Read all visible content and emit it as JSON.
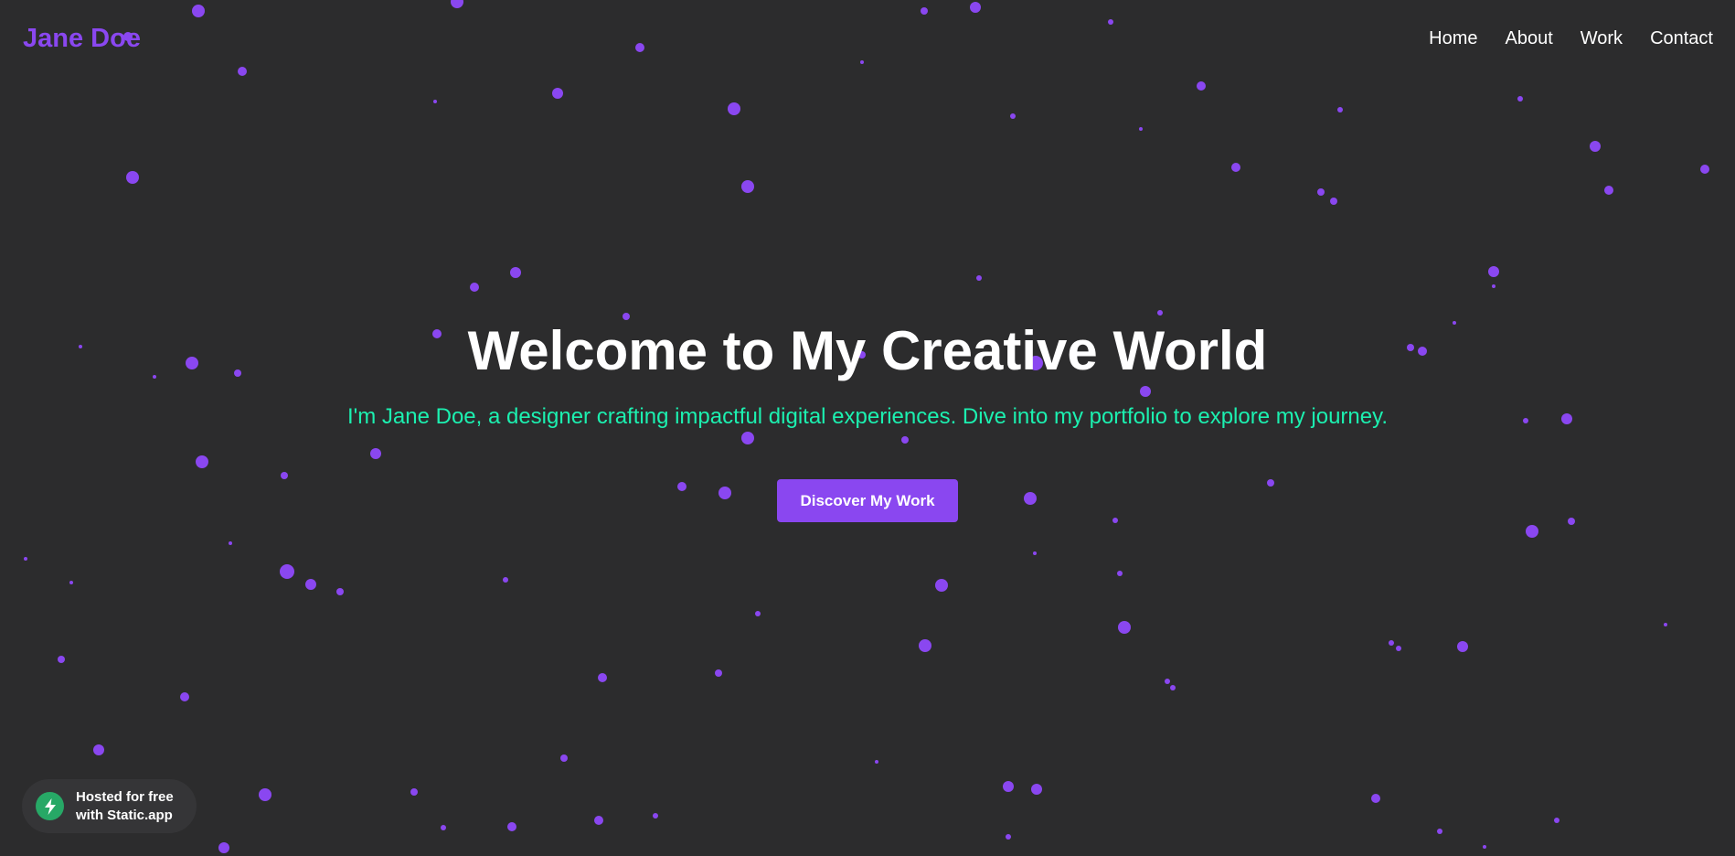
{
  "header": {
    "logo": "Jane Doe",
    "nav": [
      "Home",
      "About",
      "Work",
      "Contact"
    ]
  },
  "hero": {
    "title": "Welcome to My Creative World",
    "subtitle": "I'm Jane Doe, a designer crafting impactful digital experiences. Dive into my portfolio to explore my journey.",
    "cta_label": "Discover My Work"
  },
  "badge": {
    "text": "Hosted for free with Static.app",
    "icon": "lightning-bolt-icon"
  },
  "colors": {
    "background": "#2c2c2d",
    "accent": "#8a47f0",
    "subtitle": "#1cf0b0",
    "badge_icon": "#27a866"
  }
}
